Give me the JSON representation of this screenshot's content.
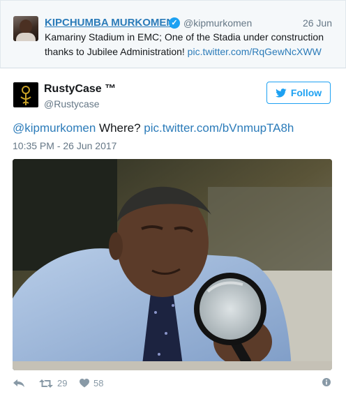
{
  "quoted_tweet": {
    "name": "KIPCHUMBA MURKOMEN",
    "handle": "@kipmurkomen",
    "date": "26 Jun",
    "text": "Kamariny Stadium in EMC; One of the Stadia under construction thanks to Jubilee Administration!",
    "link": "pic.twitter.com/RqGewNcXWW"
  },
  "tweet": {
    "name": "RustyCase ™",
    "handle": "@Rustycase",
    "follow_label": "Follow",
    "mention": "@kipmurkomen",
    "text": " Where? ",
    "link": "pic.twitter.com/bVnmupTA8h",
    "timestamp": "10:35 PM - 26 Jun 2017"
  },
  "actions": {
    "retweets": "29",
    "likes": "58"
  },
  "colors": {
    "accent": "#1da1f2",
    "link": "#2b7bb9",
    "muted": "#657786"
  }
}
